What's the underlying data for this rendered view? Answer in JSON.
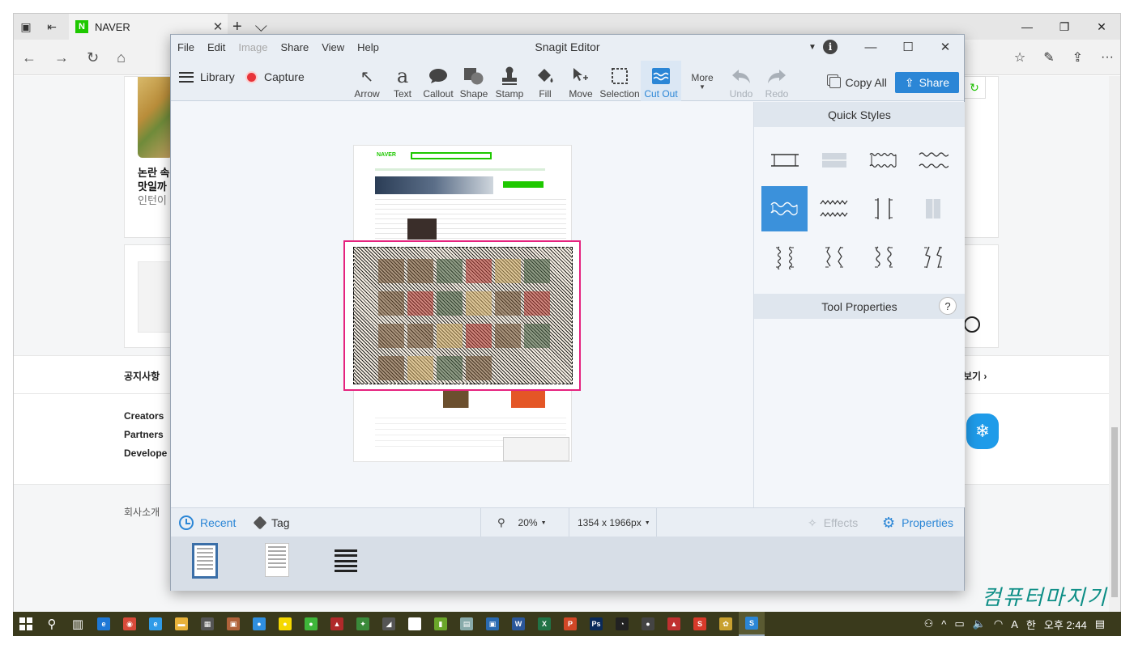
{
  "browser": {
    "tab_title": "NAVER",
    "tab_favicon": "N",
    "tab_close": "✕",
    "new_tab": "+",
    "tab_list": "⌵",
    "win_min": "—",
    "win_restore": "❐",
    "win_close": "✕",
    "nav": {
      "back": "←",
      "forward": "→",
      "refresh": "↻",
      "home": "⌂"
    },
    "nav_right": {
      "favorites": "☆",
      "notes": "✎",
      "share": "⇪",
      "more": "···"
    }
  },
  "naver_page": {
    "news_line1": "논란 속",
    "news_line2": "맛일까",
    "news_line3": "인턴이",
    "refresh": "↻",
    "notice_label": "공지사항",
    "notice_more": "보기 ›",
    "footer_links": [
      "Creators",
      "Partners",
      "Develope"
    ],
    "company": "회사소개",
    "badge": "❄"
  },
  "watermark": "컴퓨터마지기",
  "snagit": {
    "title": "Snagit Editor",
    "menus": [
      {
        "label": "File",
        "enabled": true
      },
      {
        "label": "Edit",
        "enabled": true
      },
      {
        "label": "Image",
        "enabled": false
      },
      {
        "label": "Share",
        "enabled": true
      },
      {
        "label": "View",
        "enabled": true
      },
      {
        "label": "Help",
        "enabled": true
      }
    ],
    "info": "i",
    "win_min": "—",
    "win_max": "☐",
    "win_close": "✕",
    "library": "Library",
    "capture": "Capture",
    "tools": [
      {
        "label": "Arrow",
        "icon": "↖",
        "state": "normal"
      },
      {
        "label": "Text",
        "icon": "a",
        "state": "normal"
      },
      {
        "label": "Callout",
        "icon": "💬",
        "state": "normal"
      },
      {
        "label": "Shape",
        "icon": "■",
        "state": "normal"
      },
      {
        "label": "Stamp",
        "icon": "⍊",
        "state": "normal"
      },
      {
        "label": "Fill",
        "icon": "◆",
        "state": "normal"
      },
      {
        "label": "Move",
        "icon": "⇱",
        "state": "normal"
      },
      {
        "label": "Selection",
        "icon": "⬚",
        "state": "normal"
      },
      {
        "label": "Cut Out",
        "icon": "≋",
        "state": "active"
      }
    ],
    "more": "More",
    "undo": "Undo",
    "redo": "Redo",
    "copy_all": "Copy All",
    "share": "Share",
    "quick_styles": "Quick Styles",
    "tool_properties": "Tool Properties",
    "help": "?",
    "selected_style_index": 4,
    "status": {
      "recent": "Recent",
      "tag": "Tag",
      "zoom": "20%",
      "dimensions": "1354 x 1966px",
      "effects": "Effects",
      "properties": "Properties"
    }
  },
  "taskbar": {
    "time": "오후 2:44",
    "ime": "A",
    "lang": "한",
    "apps": [
      {
        "icon": "search-icon",
        "glyph": "⚲",
        "color": "#3a3a1c"
      },
      {
        "icon": "task-view-icon",
        "glyph": "▥",
        "color": "#3a3a1c"
      },
      {
        "icon": "edge-icon",
        "glyph": "e",
        "color": "#1e78d6"
      },
      {
        "icon": "chrome-icon",
        "glyph": "◉",
        "color": "#d84a3a"
      },
      {
        "icon": "ie-icon",
        "glyph": "e",
        "color": "#2f9be8"
      },
      {
        "icon": "explorer-icon",
        "glyph": "▬",
        "color": "#e8b23a"
      },
      {
        "icon": "calculator-icon",
        "glyph": "▦",
        "color": "#555"
      },
      {
        "icon": "app-icon",
        "glyph": "▣",
        "color": "#b0623a"
      },
      {
        "icon": "messenger-icon",
        "glyph": "●",
        "color": "#2f8fe0"
      },
      {
        "icon": "kakaotalk-icon",
        "glyph": "●",
        "color": "#f5d800"
      },
      {
        "icon": "wechat-icon",
        "glyph": "●",
        "color": "#3fb63a"
      },
      {
        "icon": "app-icon",
        "glyph": "▲",
        "color": "#b02a2a"
      },
      {
        "icon": "app-icon",
        "glyph": "✦",
        "color": "#3a8a3a"
      },
      {
        "icon": "app-icon",
        "glyph": "◢",
        "color": "#555"
      },
      {
        "icon": "app-icon",
        "glyph": "◎",
        "color": "#fff"
      },
      {
        "icon": "chart-icon",
        "glyph": "▮",
        "color": "#6aa62a"
      },
      {
        "icon": "notepad-icon",
        "glyph": "▤",
        "color": "#8aa"
      },
      {
        "icon": "app-icon",
        "glyph": "▣",
        "color": "#2a6ab0"
      },
      {
        "icon": "word-icon",
        "glyph": "W",
        "color": "#2b579a"
      },
      {
        "icon": "excel-icon",
        "glyph": "X",
        "color": "#217346"
      },
      {
        "icon": "powerpoint-icon",
        "glyph": "P",
        "color": "#d24726"
      },
      {
        "icon": "photoshop-icon",
        "glyph": "Ps",
        "color": "#0a2a5a"
      },
      {
        "icon": "speed-icon",
        "glyph": "◔",
        "color": "#222"
      },
      {
        "icon": "app-icon",
        "glyph": "●",
        "color": "#444"
      },
      {
        "icon": "app-icon",
        "glyph": "▲",
        "color": "#c03030"
      },
      {
        "icon": "app-icon",
        "glyph": "S",
        "color": "#d83a2a"
      },
      {
        "icon": "app-icon",
        "glyph": "✿",
        "color": "#c8a030"
      },
      {
        "icon": "snagit-icon",
        "glyph": "S",
        "color": "#2b86d6"
      }
    ]
  }
}
